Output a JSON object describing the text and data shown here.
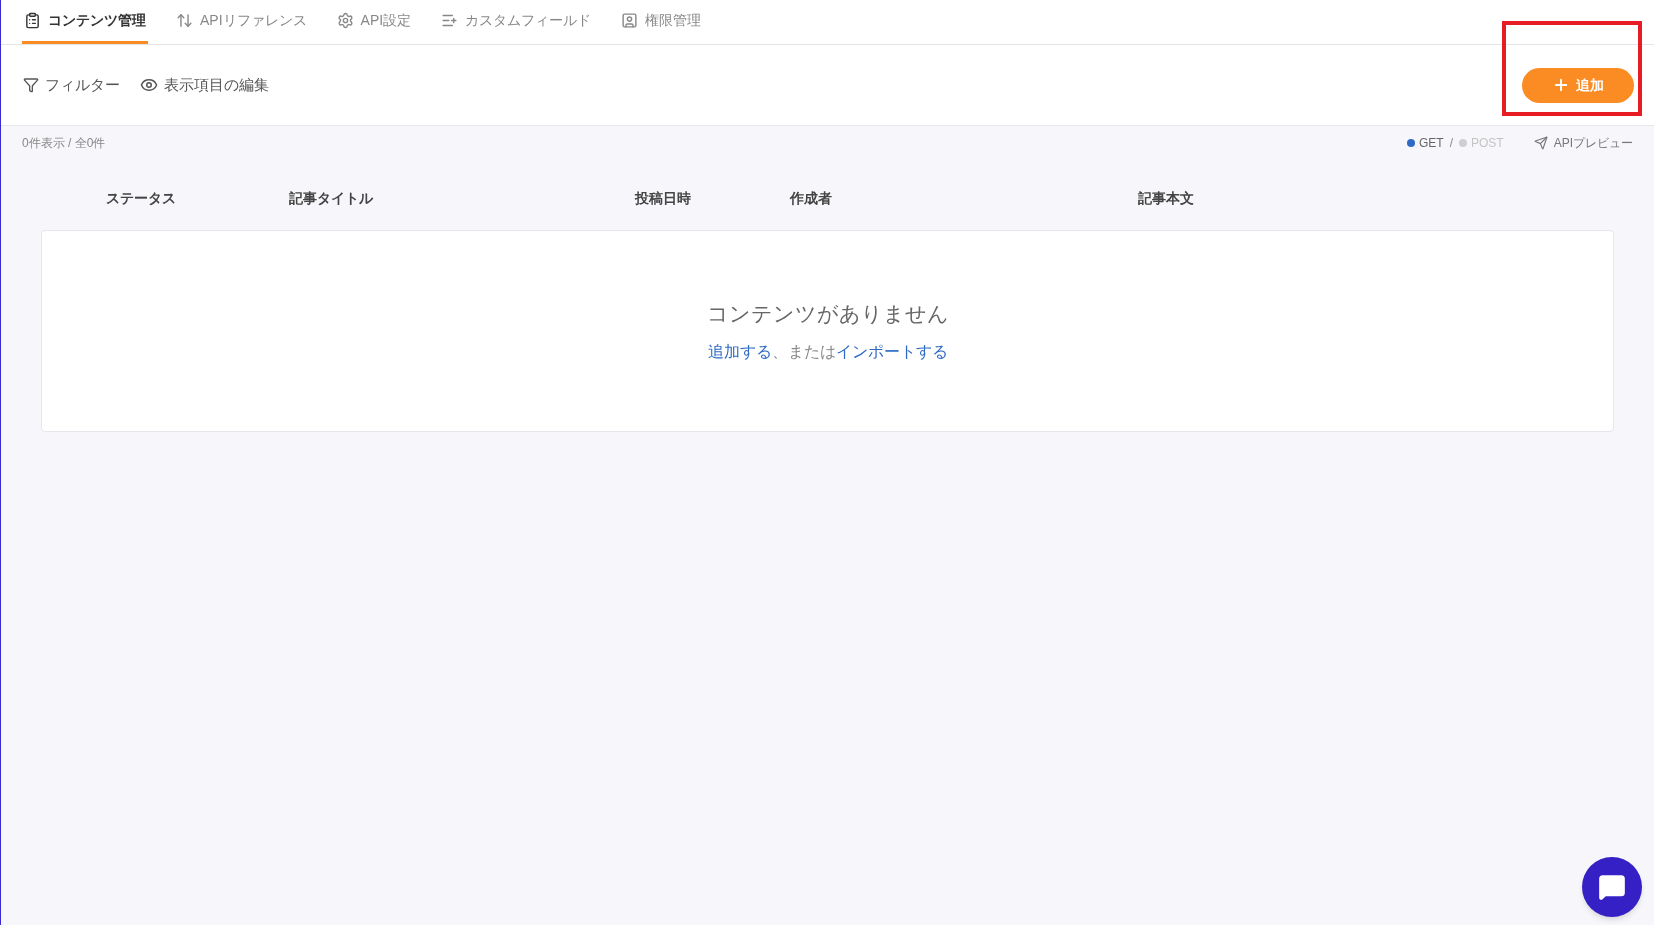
{
  "tabs": [
    {
      "label": "コンテンツ管理",
      "kind": "contents",
      "selected": true
    },
    {
      "label": "APIリファレンス",
      "kind": "reference",
      "selected": false
    },
    {
      "label": "API設定",
      "kind": "settings",
      "selected": false
    },
    {
      "label": "カスタムフィールド",
      "kind": "fields",
      "selected": false
    },
    {
      "label": "権限管理",
      "kind": "permissions",
      "selected": false
    }
  ],
  "toolbar": {
    "filter": "フィルター",
    "edit_columns": "表示項目の編集",
    "add_button": {
      "label": "追加",
      "highlighted": true
    }
  },
  "count": "0件表示 / 全0件",
  "methods": [
    {
      "label": "GET",
      "selected": true
    },
    {
      "label": "POST",
      "selected": false
    }
  ],
  "method_separator": "/",
  "api_preview": "APIプレビュー",
  "table": {
    "columns": [
      "ステータス",
      "記事タイトル",
      "投稿日時",
      "作成者",
      "記事本文"
    ]
  },
  "empty": {
    "title": "コンテンツがありません",
    "message": [
      {
        "kind": "link",
        "text": "追加する"
      },
      {
        "kind": "text",
        "text": "、または"
      },
      {
        "kind": "link",
        "text": "インポートする"
      }
    ]
  }
}
